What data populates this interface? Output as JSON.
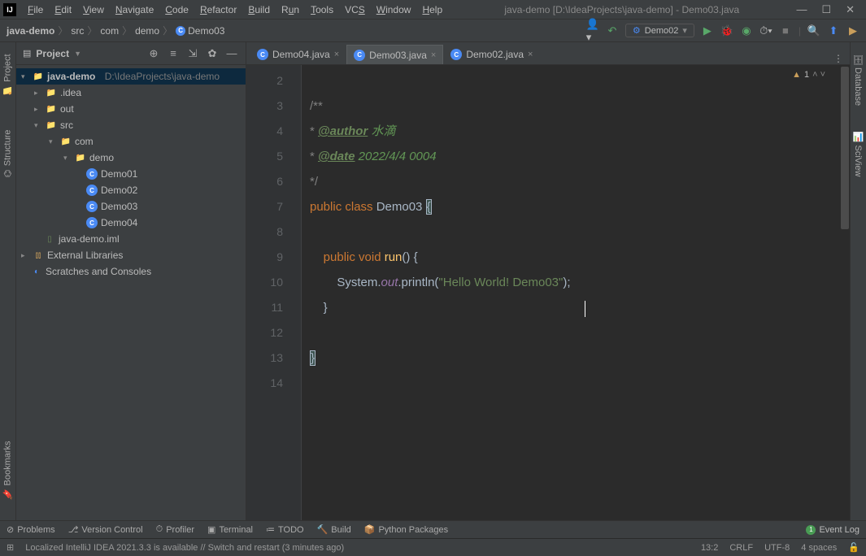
{
  "title": "java-demo [D:\\IdeaProjects\\java-demo] - Demo03.java",
  "menu": [
    "File",
    "Edit",
    "View",
    "Navigate",
    "Code",
    "Refactor",
    "Build",
    "Run",
    "Tools",
    "VCS",
    "Window",
    "Help"
  ],
  "breadcrumbs": {
    "project": "java-demo",
    "src": "src",
    "pkg1": "com",
    "pkg2": "demo",
    "cls": "Demo03"
  },
  "run_config": {
    "label": "Demo02"
  },
  "left_tabs": {
    "project": "Project",
    "structure": "Structure",
    "bookmarks": "Bookmarks"
  },
  "right_tabs": {
    "database": "Database",
    "sciview": "SciView"
  },
  "panel": {
    "title": "Project",
    "tree": {
      "root": "java-demo",
      "root_path": "D:\\IdeaProjects\\java-demo",
      "idea": ".idea",
      "out": "out",
      "src": "src",
      "com": "com",
      "demo": "demo",
      "d1": "Demo01",
      "d2": "Demo02",
      "d3": "Demo03",
      "d4": "Demo04",
      "iml": "java-demo.iml",
      "ext": "External Libraries",
      "scratch": "Scratches and Consoles"
    }
  },
  "tabs": [
    {
      "label": "Demo04.java",
      "active": false,
      "close": true
    },
    {
      "label": "Demo03.java",
      "active": true,
      "close": true
    },
    {
      "label": "Demo02.java",
      "active": false,
      "close": true
    }
  ],
  "warnings": {
    "count": "1"
  },
  "code_lines": {
    "l2": "",
    "l3": "/**",
    "l4_tag": "@author",
    "l4_txt": " 水滴",
    "l5_tag": "@date",
    "l5_txt": " 2022/4/4 0004",
    "l6": " */",
    "l7_public": "public ",
    "l7_class": "class ",
    "l7_name": "Demo03 ",
    "l7_brace": "{",
    "l9_public": "public ",
    "l9_void": "void ",
    "l9_name": "run",
    "l9_rest": "() {",
    "l10_sys": "System.",
    "l10_out": "out",
    "l10_println": ".println(",
    "l10_str": "\"Hello World! Demo03\"",
    "l10_end": ");",
    "l11": "}",
    "l13": "}"
  },
  "gutter_lines": [
    "2",
    "3",
    "4",
    "5",
    "6",
    "7",
    "8",
    "9",
    "10",
    "11",
    "12",
    "13",
    "14"
  ],
  "bottom_tools": {
    "problems": "Problems",
    "version": "Version Control",
    "profiler": "Profiler",
    "terminal": "Terminal",
    "todo": "TODO",
    "build": "Build",
    "python": "Python Packages",
    "event": "Event Log"
  },
  "status": {
    "msg": "Localized IntelliJ IDEA 2021.3.3 is available // Switch and restart (3 minutes ago)",
    "pos": "13:2",
    "eol": "CRLF",
    "enc": "UTF-8",
    "indent": "4 spaces"
  }
}
